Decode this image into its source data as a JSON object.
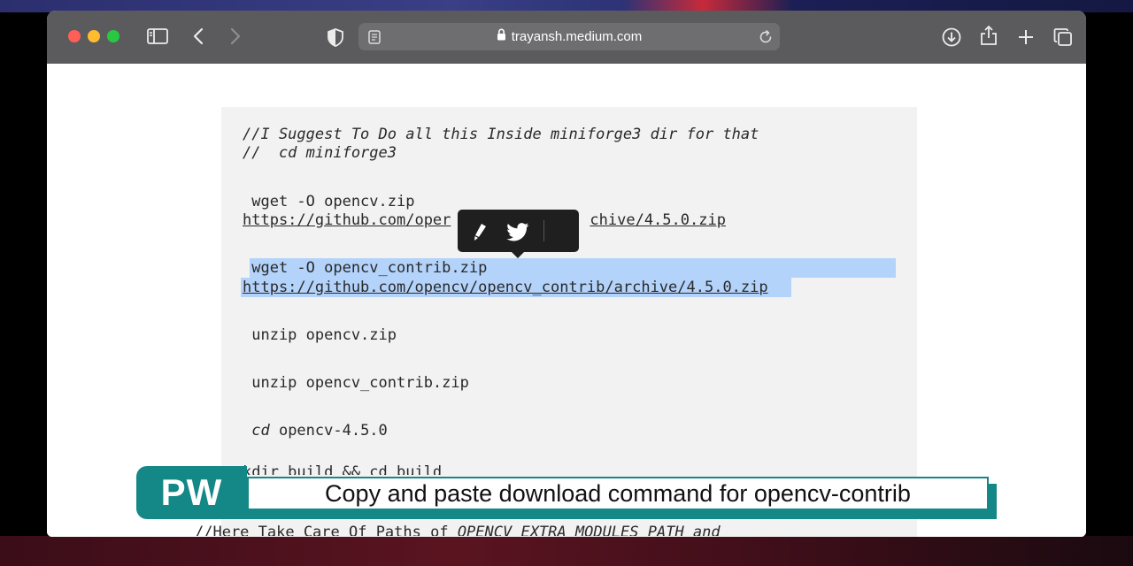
{
  "browser": {
    "url": "trayansh.medium.com"
  },
  "code": {
    "comment1": "//I Suggest To Do all this Inside miniforge3 dir for that",
    "comment2": "//  cd miniforge3",
    "wget1_cmd": " wget -O opencv.zip",
    "wget1_url_a": "https://github.com/oper",
    "wget1_url_b": "chive/4.5.0.zip",
    "wget2_cmd": " wget -O opencv_contrib.zip",
    "wget2_url": "https://github.com/opencv/opencv_contrib/archive/4.5.0.zip",
    "unzip1": " unzip opencv.zip",
    "unzip2": " unzip opencv_contrib.zip",
    "cd_kw": " cd",
    "cd_arg": " opencv-4.5.0",
    "mkdir_partial": "kdir build && cd build",
    "paths_a": "//Here Take Care Of Paths of ",
    "paths_b": "OPENCV_EXTRA_MODULES_PATH and"
  },
  "caption": {
    "badge": "PW",
    "text": "Copy and paste download command for opencv-contrib"
  },
  "icons": {
    "sidebar": "sidebar-icon",
    "back": "chevron-left-icon",
    "forward": "chevron-right-icon",
    "privacy": "shield-icon",
    "reader": "reader-icon",
    "lock": "lock-icon",
    "reload": "reload-icon",
    "download": "download-icon",
    "share": "share-icon",
    "new_tab": "plus-icon",
    "tabs": "tabs-overview-icon",
    "highlight": "highlight-pen-icon",
    "twitter": "twitter-bird-icon"
  },
  "colors": {
    "selection": "#b3d3fb",
    "caption_teal": "#148887",
    "toolbar": "#5b5b5e"
  }
}
